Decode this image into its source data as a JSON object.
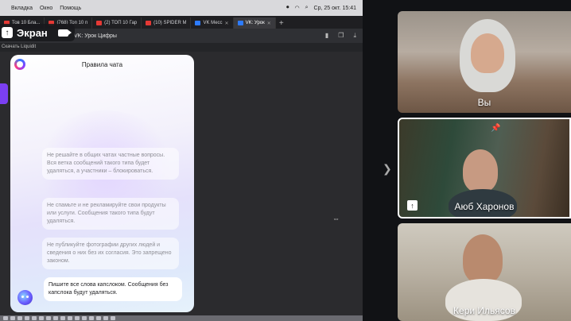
{
  "mac_menu": [
    "Вкладка",
    "Окно",
    "Помощь"
  ],
  "mac_status": {
    "date_time": "Ср, 25 окт. 15:41"
  },
  "tabs": [
    {
      "label": "Тов 10 Бла...",
      "active": false
    },
    {
      "label": "(768) Топ 10 п",
      "active": false
    },
    {
      "label": "(2) ТОП 10 Гар",
      "active": false
    },
    {
      "label": "(10) SPIDER M",
      "active": false
    },
    {
      "label": "VK Месс",
      "active": false
    },
    {
      "label": "VK: Урок",
      "active": true
    }
  ],
  "site_title": "VK: Урок Цифры",
  "bookmark": "Скачать Liquidit",
  "panel": {
    "title": "Правила чата",
    "rules": [
      "Не решайте в общих чатах частные вопросы. Вся ветка сообщений такого типа будет удаляться, а участники – блокироваться.",
      "Не спамьте и не рекламируйте свои продукты или услуги. Сообщения такого типа будут удаляться.",
      "Не публикуйте фотографии других людей и сведения о них без их согласия. Это запрещено законом."
    ],
    "last_message": "Пишите все слова капслоком. Сообщения без капслока будут удаляться."
  },
  "share": {
    "label": "Экран"
  },
  "participants": [
    {
      "name": "Вы"
    },
    {
      "name": "Аюб Харонов",
      "pinned": true
    },
    {
      "name": "Кери Ильясов"
    }
  ],
  "colors": {
    "accent": "#7b3ff2",
    "panel_bg": "#f3f1fb"
  }
}
